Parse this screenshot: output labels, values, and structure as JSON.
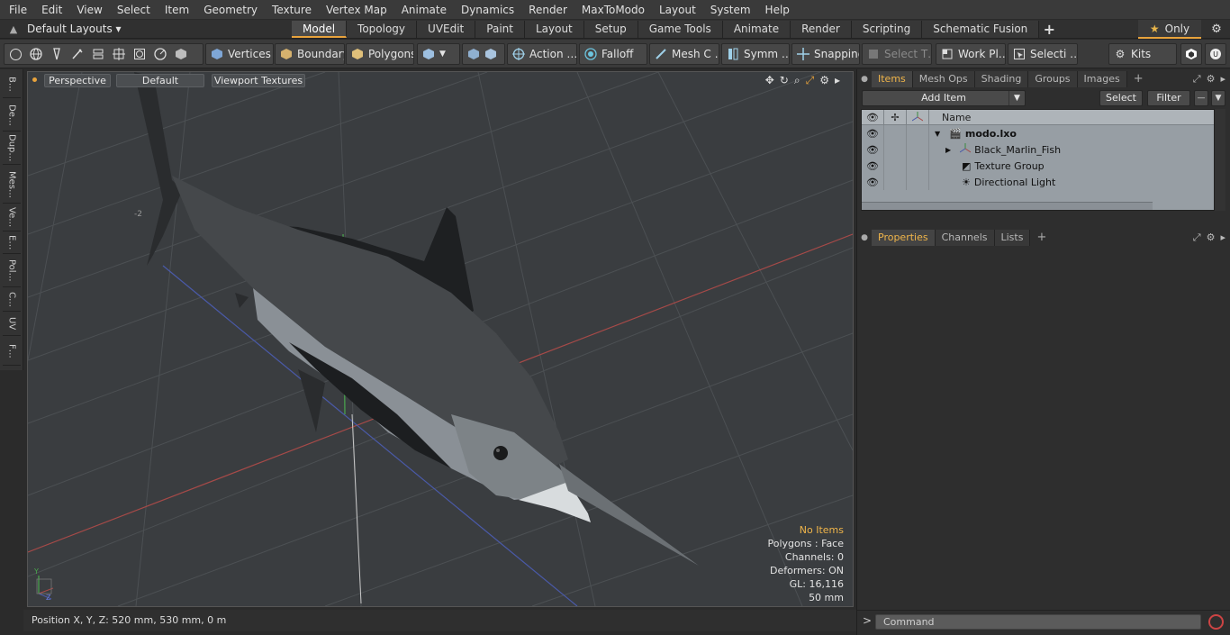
{
  "menu": [
    "File",
    "Edit",
    "View",
    "Select",
    "Item",
    "Geometry",
    "Texture",
    "Vertex Map",
    "Animate",
    "Dynamics",
    "Render",
    "MaxToModo",
    "Layout",
    "System",
    "Help"
  ],
  "layouts": {
    "label": "Default Layouts ▾"
  },
  "layout_tabs": [
    "Model",
    "Topology",
    "UVEdit",
    "Paint",
    "Layout",
    "Setup",
    "Game Tools",
    "Animate",
    "Render",
    "Scripting",
    "Schematic Fusion"
  ],
  "layout_active": "Model",
  "only_label": "Only",
  "toolbar": {
    "vertices": "Vertices",
    "boundary": "Boundary",
    "polygons": "Polygons",
    "action": "Action …",
    "falloff": "Falloff",
    "mesh": "Mesh C …",
    "symm": "Symm …",
    "snapping": "Snapping",
    "select_t": "Select T…",
    "work_pl": "Work Pl…",
    "selecti": "Selecti …",
    "kits": "Kits"
  },
  "left_tabs": [
    "B…",
    "De…",
    "Dup…",
    "Mes…",
    "Ve…",
    "E…",
    "Pol…",
    "C…",
    "UV",
    "F…"
  ],
  "viewport": {
    "view": "Perspective",
    "shading": "Default",
    "textures": "Viewport Textures",
    "info": {
      "selection": "No Items",
      "polygons": "Polygons : Face",
      "channels": "Channels: 0",
      "deformers": "Deformers: ON",
      "gl": "GL: 16,116",
      "size": "50 mm"
    },
    "axis_label": "-2",
    "gizmo": {
      "y": "Y",
      "z": "Z"
    }
  },
  "status": {
    "position": "Position X, Y, Z:   520 mm, 530 mm, 0 m"
  },
  "items_panel": {
    "tabs": [
      "Items",
      "Mesh Ops",
      "Shading",
      "Groups",
      "Images"
    ],
    "active": "Items",
    "add_item": "Add Item",
    "select": "Select",
    "filter": "Filter",
    "column_name": "Name",
    "tree": [
      {
        "label": "modo.lxo",
        "level": 0,
        "icon": "scene-icon"
      },
      {
        "label": "Black_Marlin_Fish",
        "level": 1,
        "icon": "mesh-icon"
      },
      {
        "label": "Texture Group",
        "level": 1,
        "icon": "texture-icon"
      },
      {
        "label": "Directional Light",
        "level": 1,
        "icon": "light-icon"
      }
    ]
  },
  "props_panel": {
    "tabs": [
      "Properties",
      "Channels",
      "Lists"
    ],
    "active": "Properties"
  },
  "command": {
    "placeholder": "Command"
  }
}
